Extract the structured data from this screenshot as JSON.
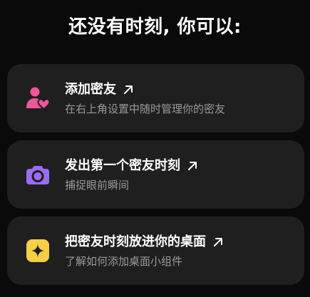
{
  "header": {
    "title": "还没有时刻, 你可以:"
  },
  "cards": [
    {
      "title": "添加密友",
      "subtitle": "在右上角设置中随时管理你的密友",
      "icon": "add-friend-icon",
      "icon_color": "#f0569a"
    },
    {
      "title": "发出第一个密友时刻",
      "subtitle": "捕捉眼前瞬间",
      "icon": "camera-icon",
      "icon_color": "#9b6cf7"
    },
    {
      "title": "把密友时刻放进你的桌面",
      "subtitle": "了解如何添加桌面小组件",
      "icon": "sparkle-icon",
      "icon_color": "#f7cf45"
    }
  ],
  "colors": {
    "background": "#0a0a0a",
    "card": "#1f1f1f",
    "subtitle": "#9a9a9a"
  }
}
